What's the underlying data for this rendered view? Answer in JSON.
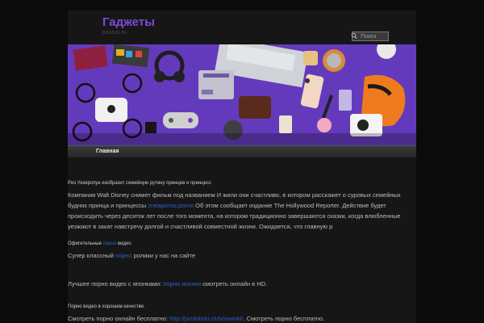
{
  "header": {
    "title": "Гаджеты",
    "description": "paurus.ru",
    "search_placeholder": "Поиск"
  },
  "nav": {
    "items": [
      {
        "label": "Главная"
      }
    ]
  },
  "posts": [
    {
      "heading": "Риз Уизерспун изобразит семейную рутину принцев и принцесс",
      "text_before": "Компания Walt Disney снимет фильм под названием И жили они счастливо, в котором расскажет о суровых семейных буднях принца и принцессы ",
      "link": "zrelaporno.porno",
      "text_after": " Об этом сообщает издание The Hollywood Reporter. Действие будет происходить через десяток лет после того момента, на котором традиционно завершаются сказки, когда влюбленные уезжают в закат навстречу долгой и счастливой совместной жизни. Ожидается, что главную р"
    },
    {
      "heading_before": "Офигительные ",
      "heading_link": "порно",
      "heading_after": " видео",
      "text_before": "Супер классный ",
      "link": "порно",
      "text_after": " ролики у нас на сайте"
    },
    {
      "text_before": "Лучшее порно видео с японками: ",
      "link": "порно японки",
      "text_after": " смотреть онлайн в HD."
    },
    {
      "heading": "Порно видео в хорошем качестве.",
      "text_before": "Смотреть порно онлайн бесплатно: ",
      "link": "http://pizdolizki.club/mamki/",
      "text_after": ". Смотреть порно бесплатно."
    }
  ],
  "colors": {
    "accent": "#7b4bd8",
    "link": "#2f5fd0",
    "background": "#0b0b0b",
    "page": "#161616",
    "banner": "#6a3fc4"
  },
  "banner_image": "gadgets-flatlay-on-purple"
}
